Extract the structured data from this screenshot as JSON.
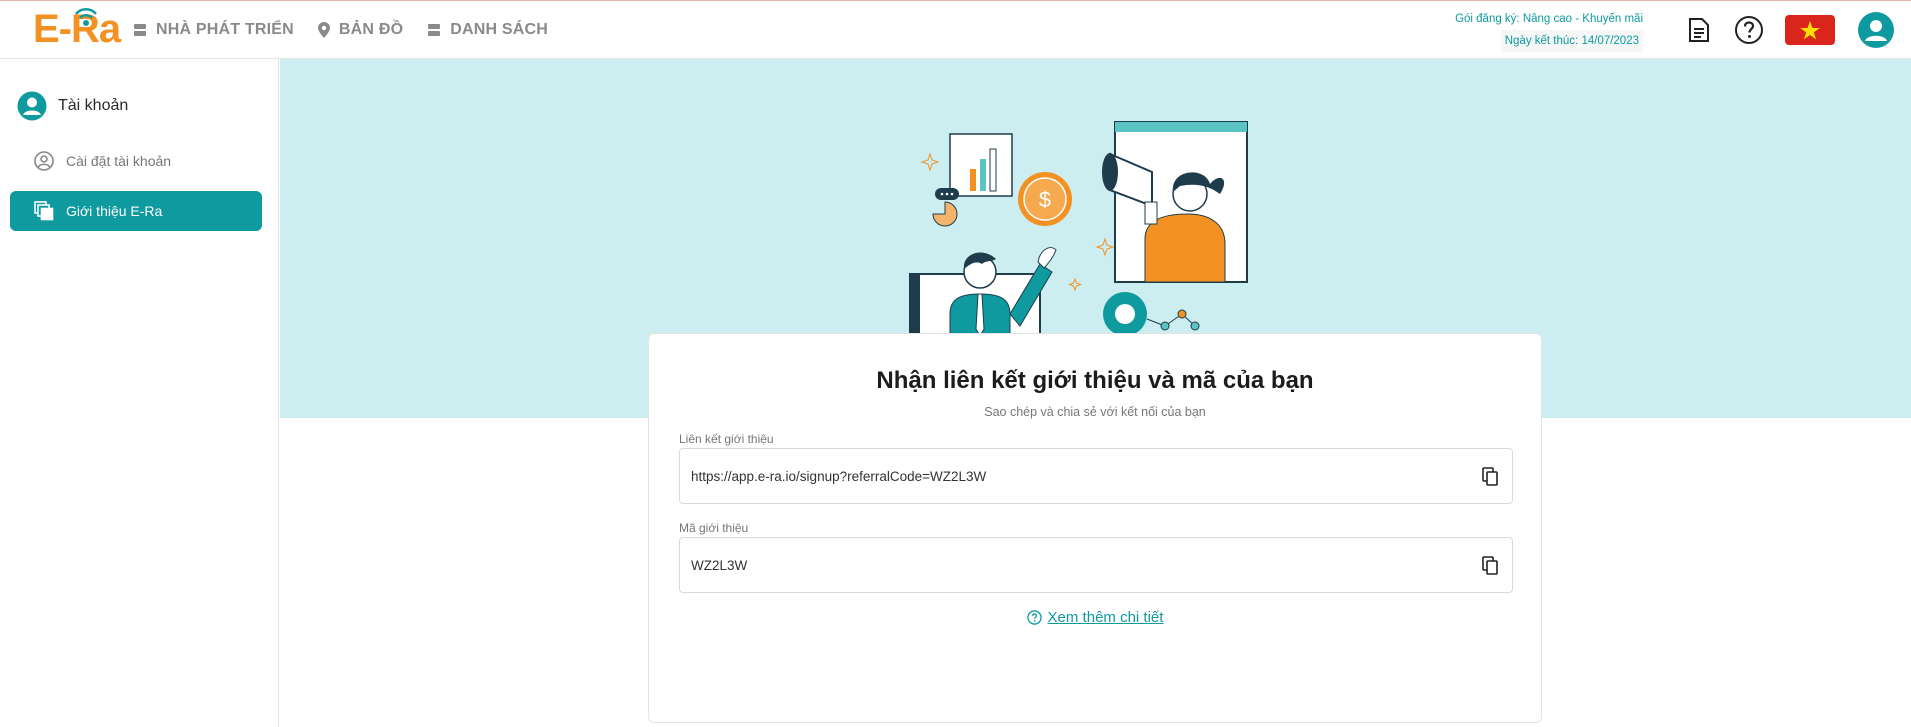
{
  "header": {
    "logo_text": "E-Ra",
    "brand_color": "#f39223",
    "accent_color": "#0f9aa0",
    "nav": [
      {
        "label": "NHÀ PHÁT TRIỂN",
        "icon": "layers-icon"
      },
      {
        "label": "BẢN ĐỒ",
        "icon": "map-pin-icon"
      },
      {
        "label": "DANH SÁCH",
        "icon": "list-icon"
      }
    ],
    "plan_line1": "Gói đăng ký: Nâng cao - Khuyến mãi",
    "plan_line2": "Ngày kết thúc: 14/07/2023",
    "icons": [
      "document-icon",
      "help-icon",
      "vietnam-flag-icon",
      "user-avatar-icon"
    ]
  },
  "sidebar": {
    "title": "Tài khoản",
    "items": [
      {
        "label": "Cài đặt tài khoản",
        "icon": "user-circle-icon",
        "active": false
      },
      {
        "label": "Giới thiệu E-Ra",
        "icon": "copy-stack-icon",
        "active": true
      }
    ]
  },
  "referral": {
    "title": "Nhận liên kết giới thiệu và mã của bạn",
    "subtitle": "Sao chép và chia sẻ với kết nối của bạn",
    "link_label": "Liên kết giới thiệu",
    "link_value": "https://app.e-ra.io/signup?referralCode=WZ2L3W",
    "code_label": "Mã giới thiệu",
    "code_value": "WZ2L3W",
    "more_label": "Xem thêm chi tiết"
  }
}
